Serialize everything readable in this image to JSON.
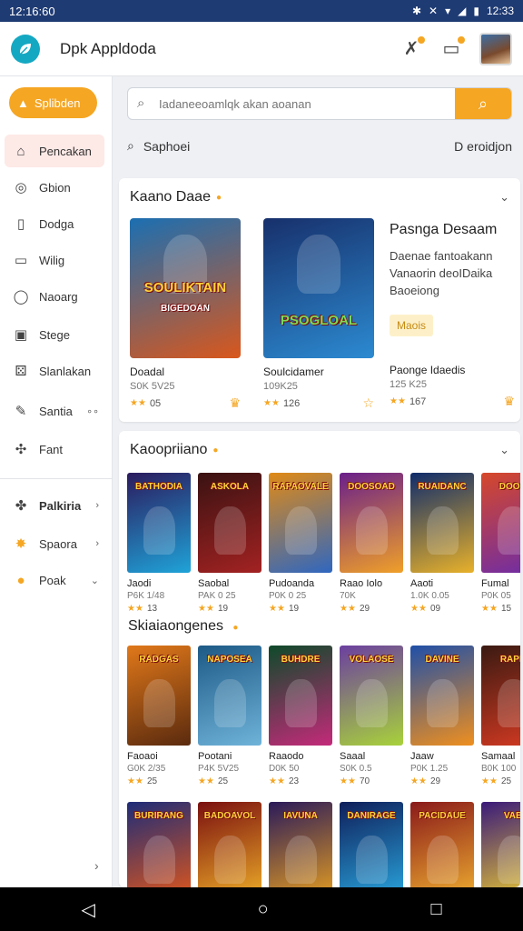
{
  "status": {
    "time": "12:16:60",
    "right_time": "12:33"
  },
  "app": {
    "title": "Dpk Appldoda"
  },
  "search": {
    "placeholder": "Iadaneeoamlqk akan aoanan"
  },
  "filter": {
    "left": "Saphoei",
    "right": "D eroidjon"
  },
  "sidebar": {
    "primary": "Splibden",
    "items": [
      {
        "label": "Pencakan",
        "icon": "home-icon"
      },
      {
        "label": "Gbion",
        "icon": "gamepad-icon"
      },
      {
        "label": "Dodga",
        "icon": "book-icon"
      },
      {
        "label": "Wilig",
        "icon": "window-icon"
      },
      {
        "label": "Naoarg",
        "icon": "user-icon"
      },
      {
        "label": "Stege",
        "icon": "calendar-icon"
      },
      {
        "label": "Slanlakan",
        "icon": "dice-icon"
      },
      {
        "label": "Santia",
        "icon": "pen-icon"
      },
      {
        "label": "Fant",
        "icon": "puzzle-icon"
      },
      {
        "label": "Palkiria",
        "icon": "puzzle-icon"
      },
      {
        "label": "Spaora",
        "icon": "sparkle-icon"
      },
      {
        "label": "Poak",
        "icon": "coin-icon"
      }
    ]
  },
  "featured": {
    "title": "Kaano Daae",
    "cards": [
      {
        "cover": "SOULIKTAIN",
        "sub_cover": "BIGEDOAN",
        "name": "Doadal",
        "sub": "S0K 5V25",
        "rating": "05",
        "c1": "#1b6fb2",
        "c2": "#d9571c"
      },
      {
        "cover": "PSOGLOAL",
        "sub_cover": "",
        "name": "Soulcidamer",
        "sub": "109K25",
        "rating": "126",
        "c1": "#17306b",
        "c2": "#2c8ad1"
      }
    ],
    "info": {
      "title": "Pasnga Desaam",
      "desc": "Daenae fantoakann Vanaorin deoIDaika Baoeiong",
      "tag": "Maois",
      "name": "Paonge Idaedis",
      "sub": "125 K25",
      "rating": "167"
    }
  },
  "section1": {
    "title": "Kaoopriiano",
    "cards": [
      {
        "cover": "BATHODIA",
        "name": "Jaodi",
        "sub": "P6K 1/48",
        "rating": "13",
        "c1": "#2b1b5e",
        "c2": "#1fa3d8"
      },
      {
        "cover": "ASKOLA",
        "name": "Saobal",
        "sub": "PAK 0 25",
        "rating": "19",
        "c1": "#3a1212",
        "c2": "#a32222"
      },
      {
        "cover": "RAPAOVALE",
        "name": "Pudoanda",
        "sub": "P0K 0 25",
        "rating": "19",
        "c1": "#e08a16",
        "c2": "#2f67c0"
      },
      {
        "cover": "DOOSOAD",
        "name": "Raao Iolo",
        "sub": "70K",
        "rating": "29",
        "c1": "#6a1f8a",
        "c2": "#f0a028"
      },
      {
        "cover": "RUAIDANC",
        "name": "Aaoti",
        "sub": "1.0K 0.05",
        "rating": "09",
        "c1": "#0f2c6b",
        "c2": "#e8b12a"
      },
      {
        "cover": "DOOG",
        "name": "Fumal",
        "sub": "P0K 05",
        "rating": "15",
        "c1": "#d6482a",
        "c2": "#6d2ca8"
      }
    ]
  },
  "section2": {
    "title": "Skiaiaongenes",
    "cards": [
      {
        "cover": "RADGAS",
        "name": "Faoaoi",
        "sub": "G0K 2/35",
        "rating": "25",
        "c1": "#e0781a",
        "c2": "#5a2a0e"
      },
      {
        "cover": "NAPOSEA",
        "name": "Pootani",
        "sub": "P4K 5V25",
        "rating": "25",
        "c1": "#1d5a86",
        "c2": "#6fb3d9"
      },
      {
        "cover": "BUHDRE",
        "name": "Raaodo",
        "sub": "D0K 50",
        "rating": "23",
        "c1": "#0e4a2a",
        "c2": "#c42a7a"
      },
      {
        "cover": "VOLAOSE",
        "name": "Saaal",
        "sub": "S0K 0.5",
        "rating": "70",
        "c1": "#6b3fa0",
        "c2": "#a8d23a"
      },
      {
        "cover": "DAVINE",
        "name": "Jaaw",
        "sub": "P0K 1.25",
        "rating": "29",
        "c1": "#1f4fa8",
        "c2": "#ef8f1e"
      },
      {
        "cover": "RAPN",
        "name": "Samaal",
        "sub": "B0K 100",
        "rating": "25",
        "c1": "#3a1a12",
        "c2": "#d63a22"
      }
    ]
  },
  "section3": {
    "cards": [
      {
        "cover": "BURIRANG",
        "c1": "#1e2c78",
        "c2": "#e2571a"
      },
      {
        "cover": "BADOAVOL",
        "c1": "#7a1010",
        "c2": "#f0b028"
      },
      {
        "cover": "IAVUNA",
        "c1": "#2a1a5a",
        "c2": "#e8a020"
      },
      {
        "cover": "DANIRAGE",
        "c1": "#0f1f5a",
        "c2": "#2aa8e0"
      },
      {
        "cover": "PACIDAUE",
        "c1": "#8a1a1a",
        "c2": "#f0b030"
      },
      {
        "cover": "VAB",
        "c1": "#3a1a7a",
        "c2": "#f0d030"
      }
    ]
  },
  "icons": {
    "logo": "leaf-logo-icon",
    "notifications": "gift-icon",
    "messages": "chat-icon"
  },
  "colors": {
    "accent": "#f5a623",
    "status_bar": "#1f3b73",
    "logo": "#15a8c2"
  }
}
